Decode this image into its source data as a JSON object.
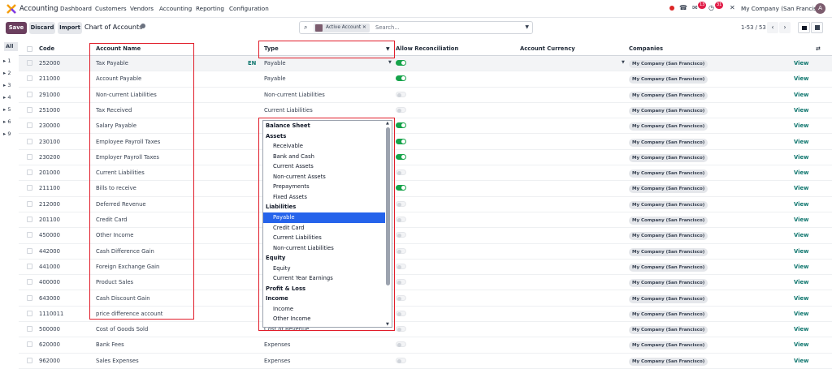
{
  "nav": {
    "app": "Accounting",
    "menus": [
      "Dashboard",
      "Customers",
      "Vendors",
      "Accounting",
      "Reporting",
      "Configuration"
    ],
    "badge1": "13",
    "badge2": "31",
    "company": "My Company (San Francisco)",
    "avatar": "A"
  },
  "control": {
    "save": "Save",
    "discard": "Discard",
    "import": "Import",
    "title": "Chart of Accounts",
    "facet": "Active Account",
    "search_placeholder": "Search...",
    "pager": "1-53 / 53"
  },
  "sidebar": {
    "all": "All",
    "items": [
      "1",
      "2",
      "3",
      "4",
      "5",
      "6",
      "9"
    ]
  },
  "columns": {
    "code": "Code",
    "name": "Account Name",
    "type": "Type",
    "recon": "Allow Reconciliation",
    "currency": "Account Currency",
    "companies": "Companies"
  },
  "rows": [
    {
      "code": "252000",
      "name": "Tax Payable",
      "type": "Payable",
      "recon": true,
      "lang": "EN"
    },
    {
      "code": "211000",
      "name": "Account Payable",
      "type": "Payable",
      "recon": true
    },
    {
      "code": "291000",
      "name": "Non-current Liabilities",
      "type": "Non-current Liabilities",
      "recon": false
    },
    {
      "code": "251000",
      "name": "Tax Received",
      "type": "Current Liabilities",
      "recon": false
    },
    {
      "code": "230000",
      "name": "Salary Payable",
      "type": "",
      "recon": true
    },
    {
      "code": "230100",
      "name": "Employee Payroll Taxes",
      "type": "",
      "recon": true
    },
    {
      "code": "230200",
      "name": "Employer Payroll Taxes",
      "type": "",
      "recon": true
    },
    {
      "code": "201000",
      "name": "Current Liabilities",
      "type": "",
      "recon": false
    },
    {
      "code": "211100",
      "name": "Bills to receive",
      "type": "",
      "recon": true
    },
    {
      "code": "212000",
      "name": "Deferred Revenue",
      "type": "",
      "recon": false
    },
    {
      "code": "201100",
      "name": "Credit Card",
      "type": "",
      "recon": false
    },
    {
      "code": "450000",
      "name": "Other Income",
      "type": "",
      "recon": false
    },
    {
      "code": "442000",
      "name": "Cash Difference Gain",
      "type": "",
      "recon": false
    },
    {
      "code": "441000",
      "name": "Foreign Exchange Gain",
      "type": "",
      "recon": false
    },
    {
      "code": "400000",
      "name": "Product Sales",
      "type": "",
      "recon": false
    },
    {
      "code": "643000",
      "name": "Cash Discount Gain",
      "type": "",
      "recon": false
    },
    {
      "code": "1110011",
      "name": "price difference account",
      "type": "",
      "recon": false
    },
    {
      "code": "500000",
      "name": "Cost of Goods Sold",
      "type": "Cost of Revenue",
      "recon": false
    },
    {
      "code": "620000",
      "name": "Bank Fees",
      "type": "Expenses",
      "recon": false
    },
    {
      "code": "962000",
      "name": "Sales Expenses",
      "type": "Expenses",
      "recon": false
    }
  ],
  "company_tag": "My Company (San Francisco)",
  "view_label": "View",
  "dropdown": [
    {
      "t": "Balance Sheet",
      "g": true
    },
    {
      "t": "Assets",
      "g": true
    },
    {
      "t": "Receivable"
    },
    {
      "t": "Bank and Cash"
    },
    {
      "t": "Current Assets"
    },
    {
      "t": "Non-current Assets"
    },
    {
      "t": "Prepayments"
    },
    {
      "t": "Fixed Assets"
    },
    {
      "t": "Liabilities",
      "g": true
    },
    {
      "t": "Payable",
      "sel": true
    },
    {
      "t": "Credit Card"
    },
    {
      "t": "Current Liabilities"
    },
    {
      "t": "Non-current Liabilities"
    },
    {
      "t": "Equity",
      "g": true
    },
    {
      "t": "Equity"
    },
    {
      "t": "Current Year Earnings"
    },
    {
      "t": "Profit & Loss",
      "g": true
    },
    {
      "t": "Income",
      "g": true
    },
    {
      "t": "Income"
    },
    {
      "t": "Other Income"
    },
    {
      "t": "Expense",
      "g": true
    }
  ],
  "colors": {
    "accent": "#6b3f5e",
    "toggle_on": "#16a34a",
    "highlight": "#e11d2a",
    "selected": "#2563eb",
    "view": "#0f766e"
  }
}
